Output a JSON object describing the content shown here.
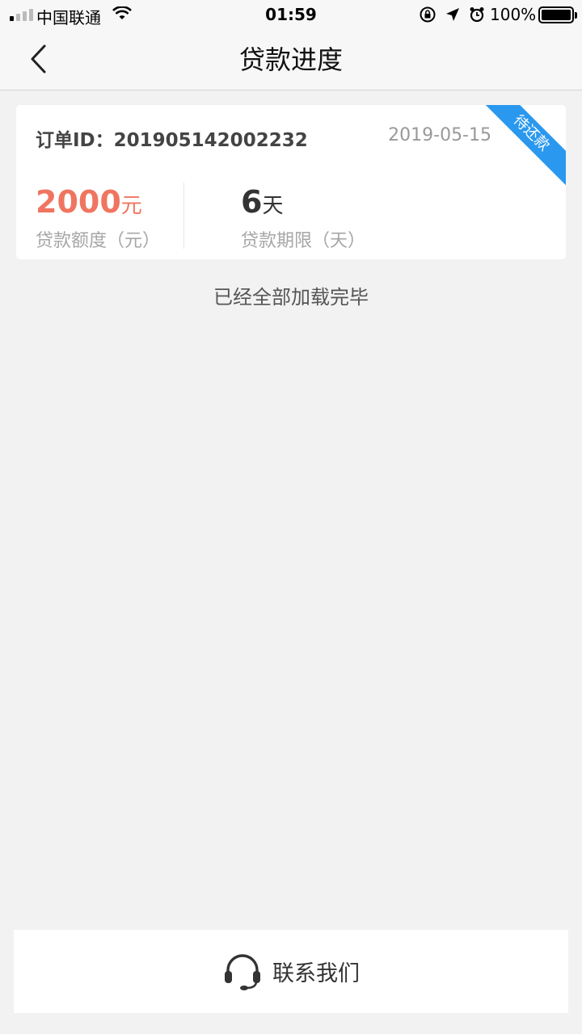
{
  "status_bar": {
    "carrier": "中国联通",
    "time": "01:59",
    "battery": "100%"
  },
  "nav": {
    "title": "贷款进度",
    "back_icon": "chevron-left-icon"
  },
  "order": {
    "id_label": "订单ID：",
    "id_value": "201905142002232",
    "date": "2019-05-15",
    "status_ribbon": "待还款",
    "ribbon_color": "#2a98ee",
    "amount_value": "2000",
    "amount_unit": "元",
    "amount_label": "贷款额度（元）",
    "amount_color": "#f07560",
    "term_value": "6",
    "term_unit": "天",
    "term_label": "贷款期限（天）"
  },
  "list_footer": "已经全部加载完毕",
  "contact": {
    "label": "联系我们",
    "icon": "headset-icon"
  }
}
